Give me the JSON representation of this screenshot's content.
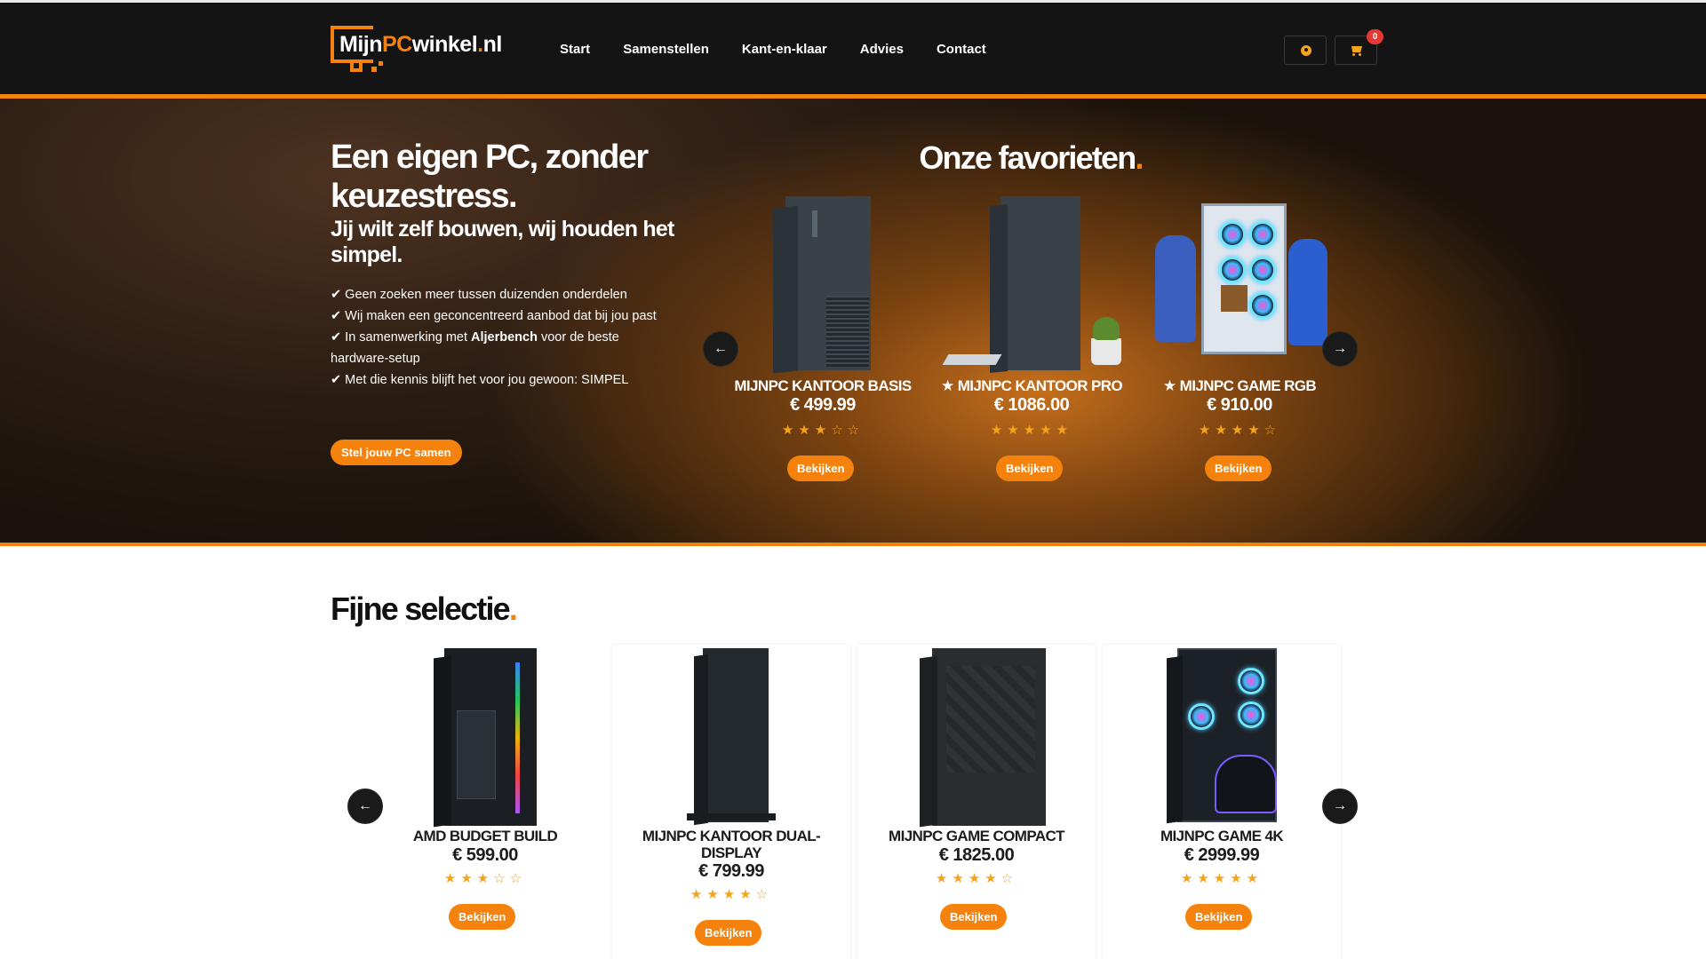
{
  "site": {
    "logo": {
      "part1": "Mijn",
      "part2": "PC",
      "part3": "winkel",
      "part4": ".",
      "part5": "nl"
    },
    "nav": [
      "Start",
      "Samenstellen",
      "Kant-en-klaar",
      "Advies",
      "Contact"
    ],
    "cart_count": "0"
  },
  "hero": {
    "title": "Een eigen PC, zonder keuzestress.",
    "subtitle": "Jij wilt zelf bouwen, wij houden het simpel.",
    "bullets": [
      {
        "pre": "✔ Geen zoeken meer tussen duizenden onderdelen",
        "bold": "",
        "post": ""
      },
      {
        "pre": "✔ Wij maken een geconcentreerd aanbod dat bij jou past",
        "bold": "",
        "post": ""
      },
      {
        "pre": "✔ In samenwerking met ",
        "bold": "Aljerbench",
        "post": " voor de beste hardware-setup"
      },
      {
        "pre": "✔ Met die kennis blijft het voor jou gewoon: SIMPEL",
        "bold": "",
        "post": ""
      }
    ],
    "cta": "Stel jouw PC samen"
  },
  "favorites": {
    "title": "Onze favorieten",
    "title_dot": ".",
    "products": [
      {
        "name": "MIJNPC KANTOOR BASIS",
        "price": "€ 499.99",
        "stars": "★★★☆☆",
        "button": "Bekijken"
      },
      {
        "name": "★ MIJNPC KANTOOR PRO",
        "price": "€ 1086.00",
        "stars": "★★★★★",
        "button": "Bekijken"
      },
      {
        "name": "★ MIJNPC GAME RGB",
        "price": "€ 910.00",
        "stars": "★★★★☆",
        "button": "Bekijken"
      }
    ]
  },
  "selection": {
    "title": "Fijne selectie",
    "title_dot": ".",
    "products": [
      {
        "name": "AMD BUDGET BUILD",
        "price": "€ 599.00",
        "stars": "★★★☆☆",
        "button": "Bekijken"
      },
      {
        "name_line1": "MIJNPC KANTOOR DUAL-",
        "name_line2": "DISPLAY",
        "price": "€ 799.99",
        "stars": "★★★★☆",
        "button": "Bekijken"
      },
      {
        "name": "MIJNPC GAME COMPACT",
        "price": "€ 1825.00",
        "stars": "★★★★☆",
        "button": "Bekijken"
      },
      {
        "name": "MIJNPC GAME 4K",
        "price": "€ 2999.99",
        "stars": "★★★★★",
        "button": "Bekijken"
      }
    ]
  },
  "icons": {
    "prev": "←",
    "next": "→"
  },
  "colors": {
    "accent": "#f5820d",
    "stars": "#f5a31a",
    "header": "#141414",
    "badge": "#e53935"
  }
}
